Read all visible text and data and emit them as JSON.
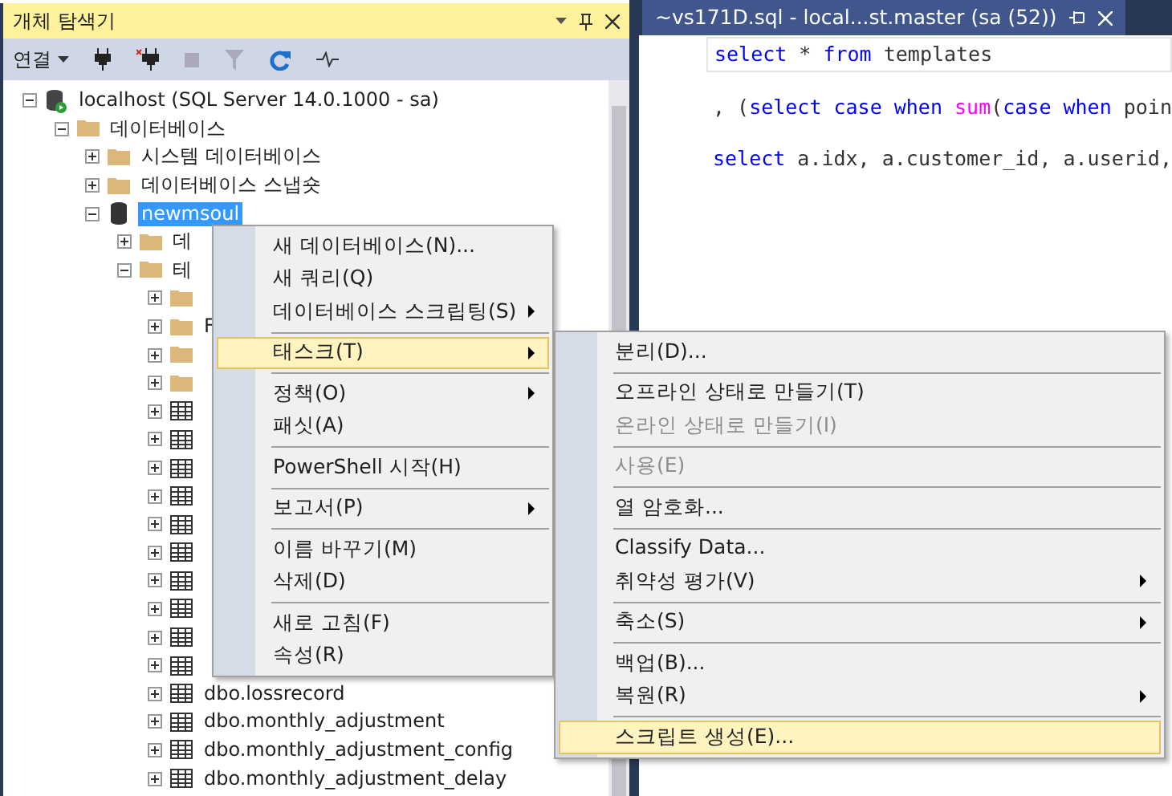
{
  "explorer": {
    "title": "개체 탐색기",
    "connect_label": "연결",
    "tree": [
      {
        "label": "localhost (SQL Server 14.0.1000 - sa)",
        "kind": "server",
        "expanded": true,
        "selected": false,
        "children": [
          {
            "label": "데이터베이스",
            "kind": "folder",
            "expanded": true,
            "selected": false,
            "children": [
              {
                "label": "시스템 데이터베이스",
                "kind": "folder",
                "expanded": false,
                "selected": false
              },
              {
                "label": "데이터베이스 스냅숏",
                "kind": "folder",
                "expanded": false,
                "selected": false
              },
              {
                "label": "newmsoul",
                "kind": "database",
                "expanded": true,
                "selected": true,
                "children": [
                  {
                    "label": "데",
                    "kind": "folder",
                    "expanded": false,
                    "selected": false
                  },
                  {
                    "label": "테",
                    "kind": "folder",
                    "expanded": true,
                    "selected": false,
                    "children": [
                      {
                        "kind": "folder",
                        "expanded": false
                      },
                      {
                        "label": "F",
                        "kind": "folder",
                        "expanded": false,
                        "selected": false
                      },
                      {
                        "kind": "folder",
                        "expanded": false
                      },
                      {
                        "kind": "folder",
                        "expanded": false
                      },
                      {
                        "kind": "table",
                        "expanded": false
                      },
                      {
                        "kind": "table",
                        "expanded": false
                      },
                      {
                        "kind": "table",
                        "expanded": false
                      },
                      {
                        "kind": "table",
                        "expanded": false
                      },
                      {
                        "kind": "table",
                        "expanded": false
                      },
                      {
                        "kind": "table",
                        "expanded": false
                      },
                      {
                        "kind": "table",
                        "expanded": false
                      },
                      {
                        "kind": "table",
                        "expanded": false
                      },
                      {
                        "kind": "table",
                        "expanded": false
                      },
                      {
                        "kind": "table",
                        "expanded": false
                      },
                      {
                        "label": "dbo.lossrecord",
                        "kind": "table",
                        "expanded": false,
                        "selected": false
                      },
                      {
                        "label": "dbo.monthly_adjustment",
                        "kind": "table",
                        "expanded": false,
                        "selected": false
                      },
                      {
                        "label": "dbo.monthly_adjustment_config",
                        "kind": "table",
                        "expanded": false,
                        "selected": false
                      },
                      {
                        "label": "dbo.monthly_adjustment_delay",
                        "kind": "table",
                        "expanded": false,
                        "selected": false
                      }
                    ]
                  }
                ]
              }
            ]
          }
        ]
      }
    ]
  },
  "editor": {
    "tab_title": "~vs171D.sql - local...st.master (sa (52))",
    "lines": [
      [
        {
          "kind": "keyword",
          "text": "select"
        },
        {
          "kind": "plain",
          "text": " * "
        },
        {
          "kind": "keyword",
          "text": "from"
        },
        {
          "kind": "plain",
          "text": " templates"
        }
      ],
      [
        {
          "kind": "plain",
          "text": ", ("
        },
        {
          "kind": "keyword",
          "text": "select case when "
        },
        {
          "kind": "function",
          "text": "sum"
        },
        {
          "kind": "plain",
          "text": "("
        },
        {
          "kind": "keyword",
          "text": "case when"
        },
        {
          "kind": "plain",
          "text": " poin"
        }
      ],
      [
        {
          "kind": "keyword",
          "text": "select"
        },
        {
          "kind": "plain",
          "text": " a.idx, a.customer_id, a.userid,"
        }
      ]
    ]
  },
  "context_menu": [
    {
      "kind": "item",
      "label": "새 데이터베이스(N)...",
      "submenu": false,
      "selected": false,
      "disabled": false
    },
    {
      "kind": "item",
      "label": "새 쿼리(Q)",
      "submenu": false,
      "selected": false,
      "disabled": false
    },
    {
      "kind": "item",
      "label": "데이터베이스 스크립팅(S)",
      "submenu": true,
      "selected": false,
      "disabled": false
    },
    {
      "kind": "separator"
    },
    {
      "kind": "item",
      "label": "태스크(T)",
      "submenu": true,
      "selected": true,
      "disabled": false
    },
    {
      "kind": "separator"
    },
    {
      "kind": "item",
      "label": "정책(O)",
      "submenu": true,
      "selected": false,
      "disabled": false
    },
    {
      "kind": "item",
      "label": "패싯(A)",
      "submenu": false,
      "selected": false,
      "disabled": false
    },
    {
      "kind": "separator"
    },
    {
      "kind": "item",
      "label": "PowerShell 시작(H)",
      "submenu": false,
      "selected": false,
      "disabled": false
    },
    {
      "kind": "separator"
    },
    {
      "kind": "item",
      "label": "보고서(P)",
      "submenu": true,
      "selected": false,
      "disabled": false
    },
    {
      "kind": "separator"
    },
    {
      "kind": "item",
      "label": "이름 바꾸기(M)",
      "submenu": false,
      "selected": false,
      "disabled": false
    },
    {
      "kind": "item",
      "label": "삭제(D)",
      "submenu": false,
      "selected": false,
      "disabled": false
    },
    {
      "kind": "separator"
    },
    {
      "kind": "item",
      "label": "새로 고침(F)",
      "submenu": false,
      "selected": false,
      "disabled": false
    },
    {
      "kind": "item",
      "label": "속성(R)",
      "submenu": false,
      "selected": false,
      "disabled": false
    }
  ],
  "task_submenu": [
    {
      "kind": "item",
      "label": "분리(D)...",
      "submenu": false,
      "selected": false,
      "disabled": false
    },
    {
      "kind": "separator"
    },
    {
      "kind": "item",
      "label": "오프라인 상태로 만들기(T)",
      "submenu": false,
      "selected": false,
      "disabled": false
    },
    {
      "kind": "item",
      "label": "온라인 상태로 만들기(I)",
      "submenu": false,
      "selected": false,
      "disabled": true
    },
    {
      "kind": "separator"
    },
    {
      "kind": "item",
      "label": "사용(E)",
      "submenu": false,
      "selected": false,
      "disabled": true
    },
    {
      "kind": "separator"
    },
    {
      "kind": "item",
      "label": "열 암호화...",
      "submenu": false,
      "selected": false,
      "disabled": false
    },
    {
      "kind": "separator"
    },
    {
      "kind": "item",
      "label": "Classify Data...",
      "submenu": false,
      "selected": false,
      "disabled": false
    },
    {
      "kind": "item",
      "label": "취약성 평가(V)",
      "submenu": true,
      "selected": false,
      "disabled": false
    },
    {
      "kind": "separator"
    },
    {
      "kind": "item",
      "label": "축소(S)",
      "submenu": true,
      "selected": false,
      "disabled": false
    },
    {
      "kind": "separator"
    },
    {
      "kind": "item",
      "label": "백업(B)...",
      "submenu": false,
      "selected": false,
      "disabled": false
    },
    {
      "kind": "item",
      "label": "복원(R)",
      "submenu": true,
      "selected": false,
      "disabled": false
    },
    {
      "kind": "separator"
    },
    {
      "kind": "item",
      "label": "스크립트 생성(E)...",
      "submenu": false,
      "selected": true,
      "disabled": false
    }
  ]
}
